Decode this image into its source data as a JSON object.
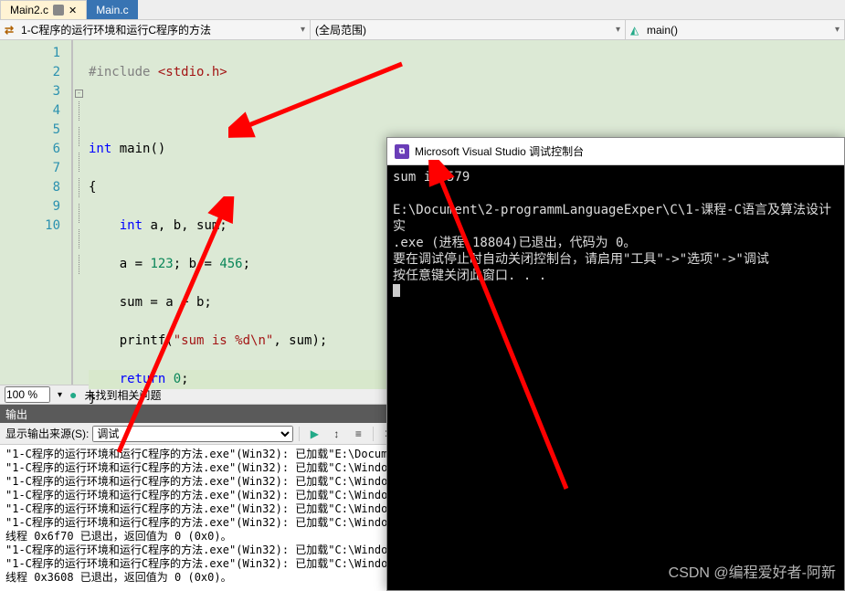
{
  "tabs": {
    "active": "Main2.c",
    "inactive": "Main.c"
  },
  "navbar": {
    "left": "1-C程序的运行环境和运行C程序的方法",
    "mid": "(全局范围)",
    "right": "main()"
  },
  "code": {
    "lines": [
      "1",
      "2",
      "3",
      "4",
      "5",
      "6",
      "7",
      "8",
      "9",
      "10"
    ],
    "src": {
      "l1_a": "#include",
      "l1_b": "<stdio.h>",
      "l3_a": "int",
      "l3_b": " main()",
      "l4": "{",
      "l5_a": "int",
      "l5_b": " a, b, sum;",
      "l6_a": "a = ",
      "l6_b": "123",
      "l6_c": "; b = ",
      "l6_d": "456",
      "l6_e": ";",
      "l7": "sum = a + b;",
      "l8_a": "printf(",
      "l8_b": "\"sum is %d\\n\"",
      "l8_c": ", sum);",
      "l9_a": "return",
      "l9_b": " 0",
      "l9_c": ";",
      "l10": "}"
    }
  },
  "zoom": {
    "value": "100 %",
    "status": "未找到相关问题"
  },
  "output": {
    "title": "输出",
    "sourceLabel": "显示输出来源(S):",
    "sourceValue": "调试",
    "lines": [
      "\"1-C程序的运行环境和运行C程序的方法.exe\"(Win32): 已加载\"E:\\Documen",
      "\"1-C程序的运行环境和运行C程序的方法.exe\"(Win32): 已加载\"C:\\Windows",
      "\"1-C程序的运行环境和运行C程序的方法.exe\"(Win32): 已加载\"C:\\Windows",
      "\"1-C程序的运行环境和运行C程序的方法.exe\"(Win32): 已加载\"C:\\Windows",
      "\"1-C程序的运行环境和运行C程序的方法.exe\"(Win32): 已加载\"C:\\Windows",
      "\"1-C程序的运行环境和运行C程序的方法.exe\"(Win32): 已加载\"C:\\Windows",
      "线程 0x6f70 已退出，返回值为 0 (0x0)。",
      "\"1-C程序的运行环境和运行C程序的方法.exe\"(Win32): 已加载\"C:\\Windows",
      "\"1-C程序的运行环境和运行C程序的方法.exe\"(Win32): 已加载\"C:\\Windows",
      "线程 0x3608 已退出，返回值为 0 (0x0)。"
    ]
  },
  "console": {
    "title": "Microsoft Visual Studio 调试控制台",
    "body": "sum is 579\n\nE:\\Document\\2-programmLanguageExper\\C\\1-课程-C语言及算法设计实\n.exe (进程 18804)已退出，代码为 0。\n要在调试停止时自动关闭控制台，请启用\"工具\"->\"选项\"->\"调试\n按任意键关闭此窗口. . ."
  },
  "watermark": "CSDN @编程爱好者-阿新"
}
